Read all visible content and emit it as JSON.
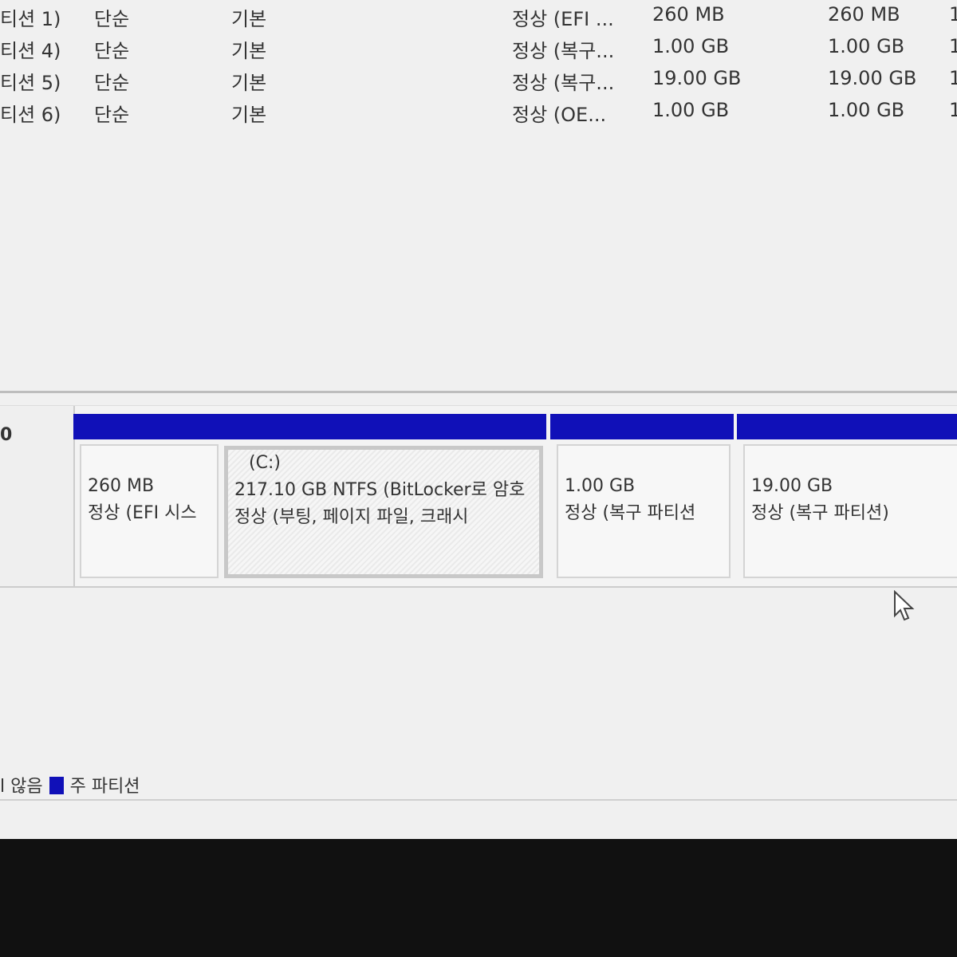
{
  "volumes": [
    {
      "name": "티션 1)",
      "layout": "단순",
      "type": "기본",
      "status": "정상 (EFI ...",
      "capacity": "260 MB",
      "free": "260 MB",
      "extra": "1"
    },
    {
      "name": "티션 4)",
      "layout": "단순",
      "type": "기본",
      "status": "정상 (복구...",
      "capacity": "1.00 GB",
      "free": "1.00 GB",
      "extra": "1"
    },
    {
      "name": "티션 5)",
      "layout": "단순",
      "type": "기본",
      "status": "정상 (복구...",
      "capacity": "19.00 GB",
      "free": "19.00 GB",
      "extra": "1"
    },
    {
      "name": "티션 6)",
      "layout": "단순",
      "type": "기본",
      "status": "정상 (OE...",
      "capacity": "1.00 GB",
      "free": "1.00 GB",
      "extra": "1"
    }
  ],
  "disk": {
    "label": "0",
    "partitions": [
      {
        "title": "",
        "size": "260 MB",
        "status": "정상 (EFI 시스"
      },
      {
        "title": "(C:)",
        "size": "217.10 GB NTFS (BitLocker로 암호",
        "status": "정상 (부팅, 페이지 파일, 크래시"
      },
      {
        "title": "",
        "size": "1.00 GB",
        "status": "정상 (복구 파티션"
      },
      {
        "title": "",
        "size": "19.00 GB",
        "status": "정상 (복구 파티션)"
      }
    ]
  },
  "legend": {
    "unallocated": "l 않음",
    "primary": "주 파티션"
  },
  "colors": {
    "primary_partition": "#1010b8"
  }
}
